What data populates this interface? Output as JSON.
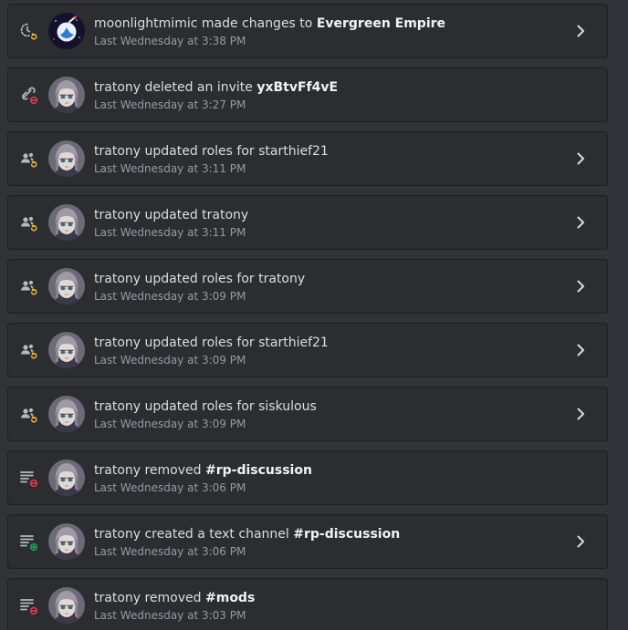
{
  "colors": {
    "background": "#313338",
    "row": "#2b2d31",
    "border": "#1e1f22",
    "text": "#dbdee1",
    "strong": "#f2f3f5",
    "muted": "#949ba4",
    "icon": "#b5bac1",
    "update": "#f0b232",
    "delete": "#f23f43",
    "create": "#23a55a"
  },
  "entries": [
    {
      "icon": "server-update-icon",
      "badge": "update",
      "avatar": "moonlightmimic-avatar",
      "text": "moonlightmimic made changes to ",
      "target": "Evergreen Empire",
      "time": "Last Wednesday at 3:38 PM",
      "expandable": true
    },
    {
      "icon": "invite-delete-icon",
      "badge": "delete",
      "avatar": "tratony-avatar",
      "text": "tratony deleted an invite ",
      "target": "yxBtvFf4vE",
      "time": "Last Wednesday at 3:27 PM",
      "expandable": false
    },
    {
      "icon": "member-role-update-icon",
      "badge": "update",
      "avatar": "tratony-avatar",
      "text": "tratony updated roles for starthief21",
      "target": "",
      "time": "Last Wednesday at 3:11 PM",
      "expandable": true
    },
    {
      "icon": "member-update-icon",
      "badge": "update",
      "avatar": "tratony-avatar",
      "text": "tratony updated tratony",
      "target": "",
      "time": "Last Wednesday at 3:11 PM",
      "expandable": true
    },
    {
      "icon": "member-role-update-icon",
      "badge": "update",
      "avatar": "tratony-avatar",
      "text": "tratony updated roles for tratony",
      "target": "",
      "time": "Last Wednesday at 3:09 PM",
      "expandable": true
    },
    {
      "icon": "member-role-update-icon",
      "badge": "update",
      "avatar": "tratony-avatar",
      "text": "tratony updated roles for starthief21",
      "target": "",
      "time": "Last Wednesday at 3:09 PM",
      "expandable": true
    },
    {
      "icon": "member-role-update-icon",
      "badge": "update",
      "avatar": "tratony-avatar",
      "text": "tratony updated roles for siskulous",
      "target": "",
      "time": "Last Wednesday at 3:09 PM",
      "expandable": true
    },
    {
      "icon": "channel-delete-icon",
      "badge": "delete",
      "avatar": "tratony-avatar",
      "text": "tratony removed ",
      "target": "#rp-discussion",
      "time": "Last Wednesday at 3:06 PM",
      "expandable": false
    },
    {
      "icon": "channel-create-icon",
      "badge": "create",
      "avatar": "tratony-avatar",
      "text": "tratony created a text channel ",
      "target": "#rp-discussion",
      "time": "Last Wednesday at 3:06 PM",
      "expandable": true
    },
    {
      "icon": "channel-delete-icon",
      "badge": "delete",
      "avatar": "tratony-avatar",
      "text": "tratony removed ",
      "target": "#mods",
      "time": "Last Wednesday at 3:03 PM",
      "expandable": false
    }
  ]
}
